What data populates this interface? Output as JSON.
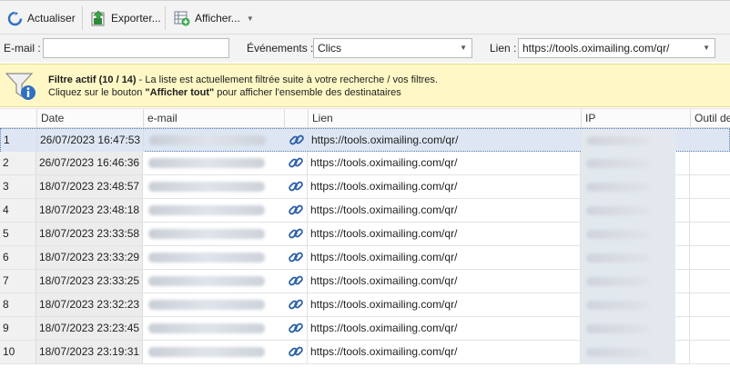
{
  "toolbar": {
    "refresh_label": "Actualiser",
    "export_label": "Exporter...",
    "show_label": "Afficher..."
  },
  "filters": {
    "email_label": "E-mail :",
    "email_value": "",
    "events_label": "Événements :",
    "events_value": "Clics",
    "link_label": "Lien :",
    "link_value": "https://tools.oximailing.com/qr/"
  },
  "banner": {
    "title": "Filtre actif (10 / 14)",
    "text1": " - La liste est actuellement filtrée suite à votre recherche / vos filtres.",
    "text2_pre": "Cliquez sur le bouton ",
    "text2_bold": "\"Afficher tout\"",
    "text2_post": " pour afficher l'ensemble des destinataires"
  },
  "columns": {
    "date": "Date",
    "email": "e-mail",
    "link": "Lien",
    "ip": "IP",
    "tool": "Outil de"
  },
  "rows": [
    {
      "num": "1",
      "date": "26/07/2023 16:47:53",
      "link": "https://tools.oximailing.com/qr/"
    },
    {
      "num": "2",
      "date": "26/07/2023 16:46:36",
      "link": "https://tools.oximailing.com/qr/"
    },
    {
      "num": "3",
      "date": "18/07/2023 23:48:57",
      "link": "https://tools.oximailing.com/qr/"
    },
    {
      "num": "4",
      "date": "18/07/2023 23:48:18",
      "link": "https://tools.oximailing.com/qr/"
    },
    {
      "num": "5",
      "date": "18/07/2023 23:33:58",
      "link": "https://tools.oximailing.com/qr/"
    },
    {
      "num": "6",
      "date": "18/07/2023 23:33:29",
      "link": "https://tools.oximailing.com/qr/"
    },
    {
      "num": "7",
      "date": "18/07/2023 23:33:25",
      "link": "https://tools.oximailing.com/qr/"
    },
    {
      "num": "8",
      "date": "18/07/2023 23:32:23",
      "link": "https://tools.oximailing.com/qr/"
    },
    {
      "num": "9",
      "date": "18/07/2023 23:23:45",
      "link": "https://tools.oximailing.com/qr/"
    },
    {
      "num": "10",
      "date": "18/07/2023 23:19:31",
      "link": "https://tools.oximailing.com/qr/"
    }
  ],
  "selected_row": 0,
  "icons": {
    "refresh": "refresh-icon",
    "export": "export-icon",
    "show": "grid-view-icon",
    "filter": "filter-info-icon",
    "link": "link-chain-icon"
  },
  "colors": {
    "banner_bg": "#fff8c6",
    "selected_row_bg": "#dde6f2",
    "link_icon": "#2a5fa8"
  }
}
